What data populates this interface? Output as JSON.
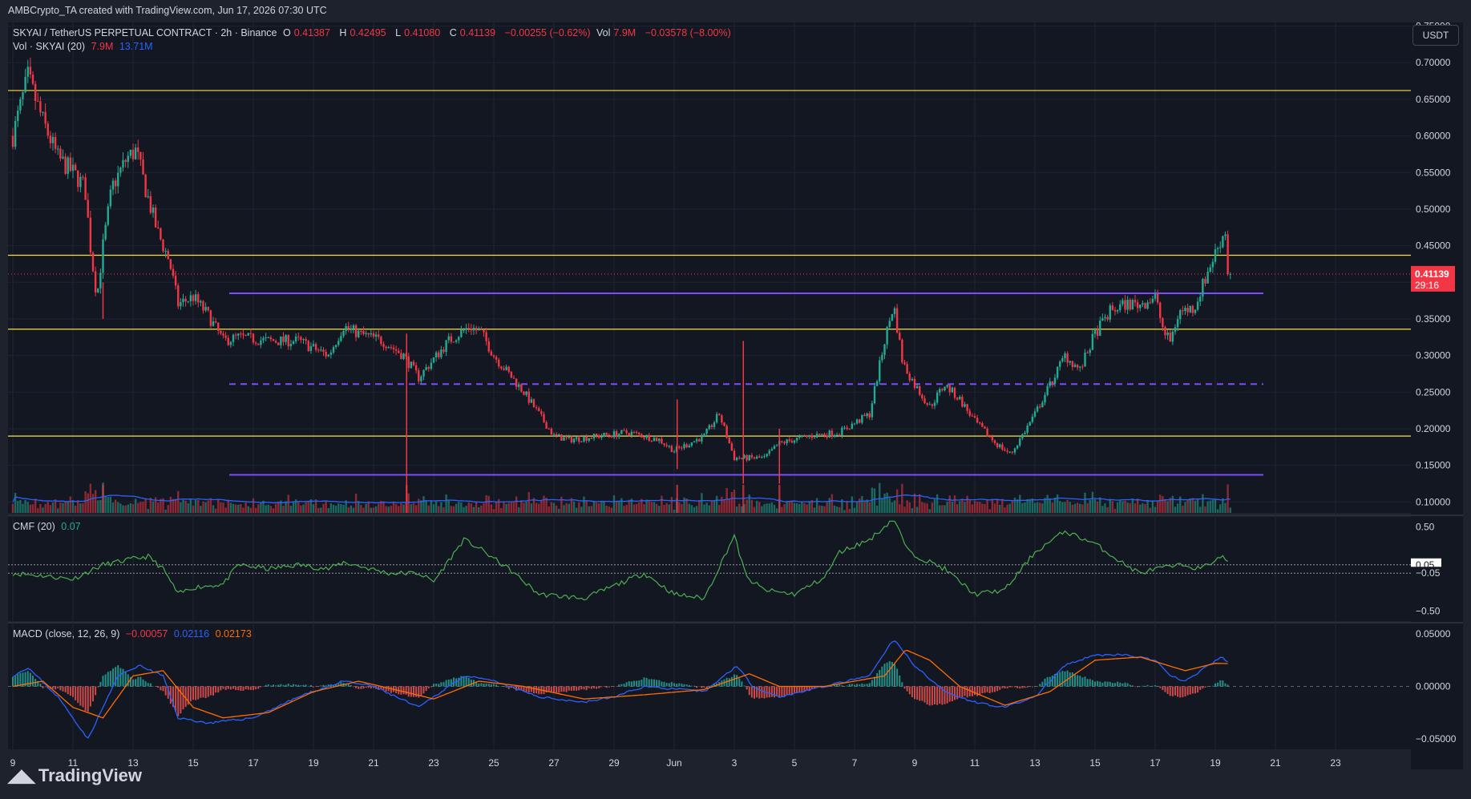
{
  "header": {
    "attribution": "AMBCrypto_TA created with TradingView.com, Jun 17, 2026 07:30 UTC"
  },
  "legend": {
    "symbol": "SKYAI / TetherUS PERPETUAL CONTRACT · 2h · Binance",
    "open_label": "O",
    "open": "0.41387",
    "high_label": "H",
    "high": "0.42495",
    "low_label": "L",
    "low": "0.41080",
    "close_label": "C",
    "close": "0.41139",
    "change": "−0.00255 (−0.62%)",
    "vol_label": "Vol",
    "vol": "7.9M",
    "vol_change": "−0.03578 (−8.00%)",
    "vol_line": "Vol · SKYAI (20)",
    "vol_val": "7.9M",
    "vol_ma": "13.71M",
    "cmf_label": "CMF (20)",
    "cmf_val": "0.07",
    "macd_label": "MACD (close, 12, 26, 9)",
    "macd_hist": "−0.00057",
    "macd_line": "0.02116",
    "macd_signal": "0.02173"
  },
  "currency_button": "USDT",
  "price_tag": {
    "price": "0.41139",
    "countdown": "29:16"
  },
  "footer_brand": "TradingView",
  "colors": {
    "background": "#131722",
    "up": "#22ab94",
    "down": "#f23645",
    "support_resistance": "#f5e04a",
    "channel": "#7b4dff",
    "vol_ma": "#2962ff",
    "cmf": "#4caf50",
    "macd": "#2962ff",
    "signal": "#ff6d00"
  },
  "chart_data": [
    {
      "type": "candlestick",
      "title": "SKYAI / TetherUS PERPETUAL CONTRACT · 2h · Binance",
      "y_axis_ticks": [
        "0.75000",
        "0.70000",
        "0.65000",
        "0.60000",
        "0.55000",
        "0.50000",
        "0.45000",
        "0.40000",
        "0.35000",
        "0.30000",
        "0.25000",
        "0.20000",
        "0.15000",
        "0.10000"
      ],
      "ylim": [
        0.085,
        0.755
      ],
      "x_axis_ticks": [
        "9",
        "11",
        "13",
        "15",
        "17",
        "19",
        "21",
        "23",
        "25",
        "27",
        "29",
        "Jun",
        "3",
        "5",
        "7",
        "9",
        "11",
        "13",
        "15",
        "17",
        "19",
        "21",
        "23"
      ],
      "price_path": [
        [
          0,
          0.6
        ],
        [
          0.5,
          0.68
        ],
        [
          1,
          0.62
        ],
        [
          1.5,
          0.57
        ],
        [
          2,
          0.55
        ],
        [
          2.4,
          0.53
        ],
        [
          2.6,
          0.44
        ],
        [
          2.8,
          0.38
        ],
        [
          3.0,
          0.45
        ],
        [
          3.3,
          0.53
        ],
        [
          3.8,
          0.57
        ],
        [
          4.1,
          0.58
        ],
        [
          4.4,
          0.53
        ],
        [
          4.8,
          0.47
        ],
        [
          5.2,
          0.43
        ],
        [
          5.5,
          0.37
        ],
        [
          6.0,
          0.38
        ],
        [
          6.5,
          0.355
        ],
        [
          7.0,
          0.32
        ],
        [
          7.5,
          0.325
        ],
        [
          8.5,
          0.32
        ],
        [
          9.5,
          0.32
        ],
        [
          10.5,
          0.3
        ],
        [
          11.0,
          0.34
        ],
        [
          11.5,
          0.33
        ],
        [
          12.3,
          0.32
        ],
        [
          13.0,
          0.3
        ],
        [
          13.5,
          0.27
        ],
        [
          14.5,
          0.32
        ],
        [
          15.2,
          0.34
        ],
        [
          15.6,
          0.33
        ],
        [
          16.0,
          0.3
        ],
        [
          17.0,
          0.25
        ],
        [
          18.0,
          0.19
        ],
        [
          18.5,
          0.185
        ],
        [
          19.5,
          0.19
        ],
        [
          20.5,
          0.195
        ],
        [
          21.0,
          0.19
        ],
        [
          21.5,
          0.185
        ],
        [
          22.0,
          0.17
        ],
        [
          23.0,
          0.19
        ],
        [
          23.5,
          0.22
        ],
        [
          24.0,
          0.16
        ],
        [
          25.0,
          0.16
        ],
        [
          25.5,
          0.18
        ],
        [
          26.5,
          0.19
        ],
        [
          27.5,
          0.195
        ],
        [
          28.5,
          0.22
        ],
        [
          29.0,
          0.32
        ],
        [
          29.3,
          0.37
        ],
        [
          29.6,
          0.29
        ],
        [
          30.0,
          0.26
        ],
        [
          30.5,
          0.23
        ],
        [
          31.0,
          0.26
        ],
        [
          31.5,
          0.24
        ],
        [
          32.0,
          0.21
        ],
        [
          32.7,
          0.18
        ],
        [
          33.2,
          0.165
        ],
        [
          34.0,
          0.22
        ],
        [
          34.5,
          0.26
        ],
        [
          35.0,
          0.3
        ],
        [
          35.5,
          0.28
        ],
        [
          36.0,
          0.33
        ],
        [
          36.5,
          0.36
        ],
        [
          37.0,
          0.37
        ],
        [
          37.5,
          0.37
        ],
        [
          38.0,
          0.38
        ],
        [
          38.3,
          0.33
        ],
        [
          38.5,
          0.32
        ],
        [
          38.8,
          0.36
        ],
        [
          39.3,
          0.365
        ],
        [
          39.8,
          0.42
        ],
        [
          40.2,
          0.46
        ],
        [
          40.4,
          0.475
        ],
        [
          40.5,
          0.41139
        ]
      ],
      "spikes": [
        {
          "x": 13.1,
          "low": 0.099,
          "high": 0.33
        },
        {
          "x": 22.1,
          "low": 0.145,
          "high": 0.24
        },
        {
          "x": 24.3,
          "low": 0.125,
          "high": 0.32
        },
        {
          "x": 25.5,
          "low": 0.125,
          "high": 0.2
        },
        {
          "x": 3.0,
          "low": 0.35,
          "high": 0.4
        }
      ],
      "horizontal_levels": [
        0.662,
        0.437,
        0.336,
        0.19
      ],
      "channel": {
        "from_x": 7.2,
        "to_x": 41.6,
        "upper": 0.385,
        "mid": 0.261,
        "lower": 0.137
      },
      "last_price": 0.41139
    },
    {
      "type": "bar",
      "title": "Vol · SKYAI (20)",
      "values_note": "volume bars with 20-period MA",
      "current": "7.9M",
      "ma": "13.71M"
    },
    {
      "type": "line",
      "title": "CMF (20)",
      "y_axis_ticks": [
        "0.50",
        "0.05",
        "−0.05",
        "−0.50"
      ],
      "ylim": [
        -0.62,
        0.62
      ],
      "levels": [
        0.05,
        -0.05
      ],
      "path": [
        [
          0,
          -0.05
        ],
        [
          1,
          -0.08
        ],
        [
          2,
          -0.12
        ],
        [
          3,
          0.05
        ],
        [
          4,
          0.12
        ],
        [
          4.5,
          0.15
        ],
        [
          5,
          0.0
        ],
        [
          5.5,
          -0.3
        ],
        [
          6,
          -0.22
        ],
        [
          7,
          -0.18
        ],
        [
          7.5,
          0.05
        ],
        [
          8.5,
          0.0
        ],
        [
          9.5,
          0.05
        ],
        [
          10.5,
          0.0
        ],
        [
          11,
          0.08
        ],
        [
          12.5,
          -0.05
        ],
        [
          13.5,
          -0.05
        ],
        [
          14,
          -0.15
        ],
        [
          15,
          0.35
        ],
        [
          15.5,
          0.25
        ],
        [
          16.5,
          0.0
        ],
        [
          17.5,
          -0.3
        ],
        [
          19,
          -0.35
        ],
        [
          20,
          -0.2
        ],
        [
          21,
          -0.05
        ],
        [
          22,
          -0.3
        ],
        [
          23,
          -0.35
        ],
        [
          24,
          0.4
        ],
        [
          24.4,
          -0.1
        ],
        [
          25,
          -0.25
        ],
        [
          26,
          -0.3
        ],
        [
          27,
          -0.1
        ],
        [
          27.5,
          0.2
        ],
        [
          28.5,
          0.35
        ],
        [
          29.3,
          0.6
        ],
        [
          29.8,
          0.2
        ],
        [
          31,
          0.0
        ],
        [
          32,
          -0.3
        ],
        [
          33,
          -0.25
        ],
        [
          34,
          0.2
        ],
        [
          35,
          0.45
        ],
        [
          36,
          0.3
        ],
        [
          37,
          0.05
        ],
        [
          37.5,
          -0.05
        ],
        [
          38,
          0.0
        ],
        [
          39,
          0.05
        ],
        [
          39.5,
          0.0
        ],
        [
          40.2,
          0.15
        ],
        [
          40.5,
          0.07
        ]
      ]
    },
    {
      "type": "line",
      "title": "MACD (close, 12, 26, 9)",
      "y_axis_ticks": [
        "0.05000",
        "0.00000",
        "−0.05000"
      ],
      "ylim": [
        -0.06,
        0.06
      ],
      "macd_path": [
        [
          0,
          0.01
        ],
        [
          0.5,
          0.018
        ],
        [
          1.5,
          -0.01
        ],
        [
          2.5,
          -0.05
        ],
        [
          3.5,
          0.01
        ],
        [
          4.2,
          0.02
        ],
        [
          5,
          0.01
        ],
        [
          5.5,
          -0.03
        ],
        [
          6.5,
          -0.035
        ],
        [
          8,
          -0.03
        ],
        [
          9.5,
          -0.01
        ],
        [
          11,
          0.005
        ],
        [
          12,
          0.0
        ],
        [
          13.5,
          -0.02
        ],
        [
          15,
          0.01
        ],
        [
          16,
          0.005
        ],
        [
          17.5,
          -0.01
        ],
        [
          19,
          -0.015
        ],
        [
          20,
          -0.01
        ],
        [
          21,
          0.0
        ],
        [
          23,
          -0.005
        ],
        [
          24.1,
          0.02
        ],
        [
          24.6,
          0.0
        ],
        [
          25.5,
          -0.01
        ],
        [
          27,
          0.0
        ],
        [
          28.5,
          0.01
        ],
        [
          29.3,
          0.045
        ],
        [
          30,
          0.02
        ],
        [
          31,
          -0.005
        ],
        [
          32,
          -0.015
        ],
        [
          33,
          -0.02
        ],
        [
          34,
          -0.01
        ],
        [
          35,
          0.02
        ],
        [
          36,
          0.03
        ],
        [
          37,
          0.03
        ],
        [
          38,
          0.025
        ],
        [
          38.5,
          0.01
        ],
        [
          39,
          0.005
        ],
        [
          40.2,
          0.028
        ],
        [
          40.5,
          0.02116
        ]
      ],
      "signal_path": [
        [
          0,
          0.0
        ],
        [
          1,
          0.005
        ],
        [
          2,
          -0.02
        ],
        [
          3,
          -0.03
        ],
        [
          4,
          0.01
        ],
        [
          5,
          0.015
        ],
        [
          6,
          -0.02
        ],
        [
          7,
          -0.03
        ],
        [
          8.5,
          -0.025
        ],
        [
          10,
          -0.005
        ],
        [
          11.5,
          0.005
        ],
        [
          13,
          -0.005
        ],
        [
          14,
          -0.012
        ],
        [
          15.5,
          0.005
        ],
        [
          17,
          0.0
        ],
        [
          19,
          -0.012
        ],
        [
          21,
          -0.008
        ],
        [
          23,
          -0.003
        ],
        [
          24.5,
          0.012
        ],
        [
          25.5,
          0.0
        ],
        [
          27,
          0.0
        ],
        [
          29,
          0.01
        ],
        [
          29.7,
          0.035
        ],
        [
          30.5,
          0.025
        ],
        [
          31.5,
          0.0
        ],
        [
          33,
          -0.018
        ],
        [
          34.5,
          -0.005
        ],
        [
          36,
          0.025
        ],
        [
          37.5,
          0.028
        ],
        [
          39,
          0.015
        ],
        [
          40,
          0.022
        ],
        [
          40.5,
          0.02173
        ]
      ],
      "current": {
        "hist": "−0.00057",
        "macd": "0.02116",
        "signal": "0.02173"
      }
    }
  ]
}
